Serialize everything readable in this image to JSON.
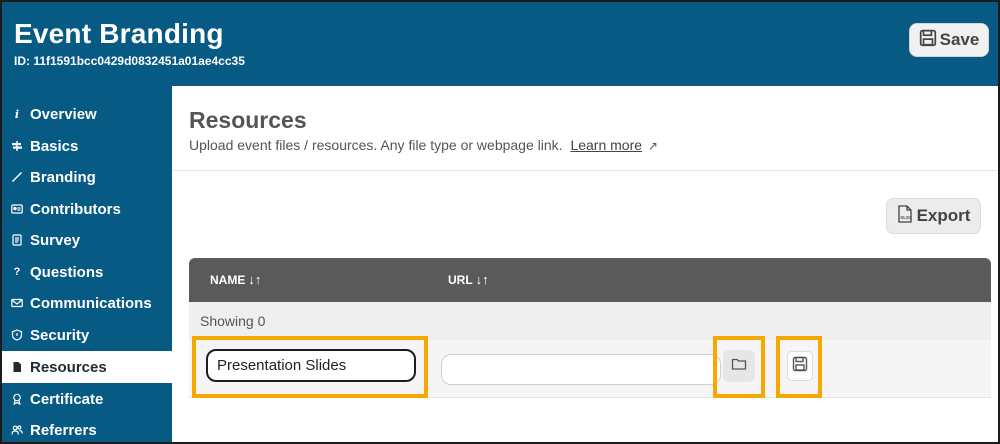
{
  "header": {
    "title": "Event Branding",
    "event_id": "ID: 11f1591bcc0429d0832451a01ae4cc35",
    "save_label": "Save"
  },
  "sidebar": {
    "items": [
      {
        "label": "Overview",
        "icon": "info-icon",
        "active": false
      },
      {
        "label": "Basics",
        "icon": "signpost-icon",
        "active": false
      },
      {
        "label": "Branding",
        "icon": "brush-icon",
        "active": false
      },
      {
        "label": "Contributors",
        "icon": "id-card-icon",
        "active": false
      },
      {
        "label": "Survey",
        "icon": "clipboard-icon",
        "active": false
      },
      {
        "label": "Questions",
        "icon": "question-icon",
        "active": false
      },
      {
        "label": "Communications",
        "icon": "envelope-icon",
        "active": false
      },
      {
        "label": "Security",
        "icon": "shield-icon",
        "active": false
      },
      {
        "label": "Resources",
        "icon": "file-icon",
        "active": true
      },
      {
        "label": "Certificate",
        "icon": "award-icon",
        "active": false
      },
      {
        "label": "Referrers",
        "icon": "people-icon",
        "active": false
      }
    ]
  },
  "main": {
    "title": "Resources",
    "subtitle": "Upload event files / resources. Any file type or webpage link.",
    "learn_more": "Learn more",
    "export_label": "Export",
    "table": {
      "columns": [
        "NAME",
        "URL"
      ],
      "showing_text": "Showing 0",
      "new_row": {
        "name_value": "Presentation Slides",
        "url_value": ""
      }
    }
  },
  "colors": {
    "header_bg": "#075a84",
    "highlight": "#f5a800",
    "table_header_bg": "#5a5a5a"
  }
}
